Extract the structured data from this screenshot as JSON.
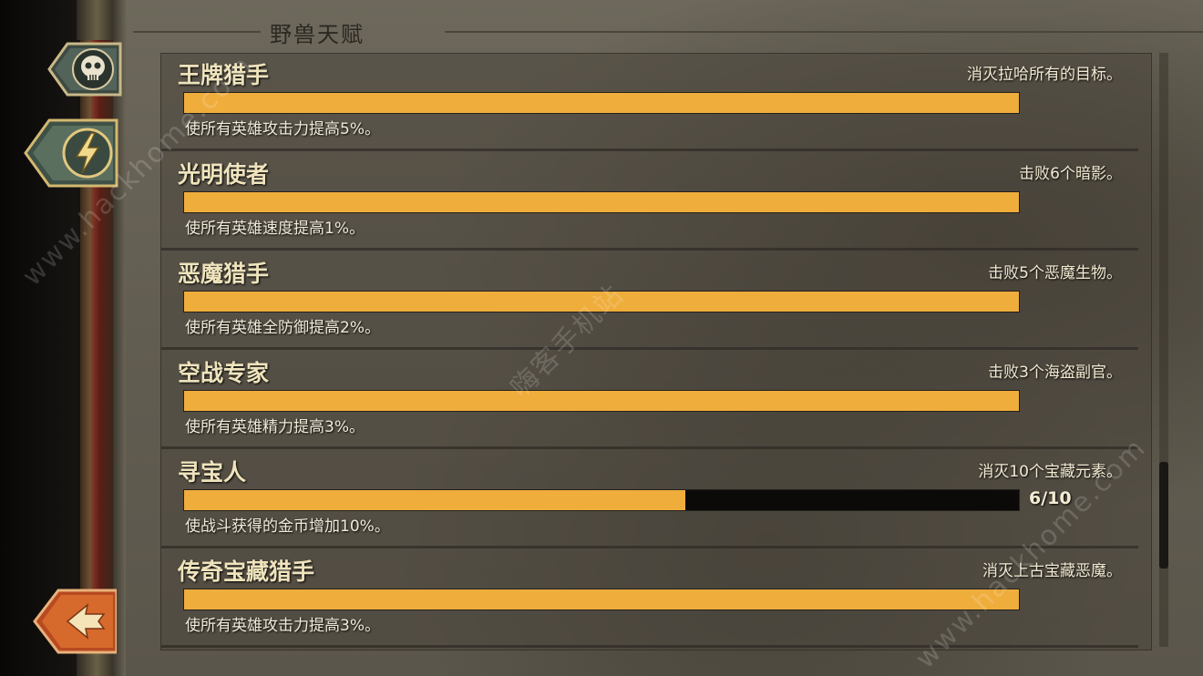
{
  "panel": {
    "title": "野兽天赋"
  },
  "talents": [
    {
      "name": "王牌猎手",
      "task": "消灭拉哈所有的目标。",
      "progress": 1.0,
      "count": "",
      "effect": "使所有英雄攻击力提高5%。"
    },
    {
      "name": "光明使者",
      "task": "击败6个暗影。",
      "progress": 1.0,
      "count": "",
      "effect": "使所有英雄速度提高1%。"
    },
    {
      "name": "恶魔猎手",
      "task": "击败5个恶魔生物。",
      "progress": 1.0,
      "count": "",
      "effect": "使所有英雄全防御提高2%。"
    },
    {
      "name": "空战专家",
      "task": "击败3个海盗副官。",
      "progress": 1.0,
      "count": "",
      "effect": "使所有英雄精力提高3%。"
    },
    {
      "name": "寻宝人",
      "task": "消灭10个宝藏元素。",
      "progress": 0.6,
      "count": "6/10",
      "effect": "使战斗获得的金币增加10%。"
    },
    {
      "name": "传奇宝藏猎手",
      "task": "消灭上古宝藏恶魔。",
      "progress": 1.0,
      "count": "",
      "effect": "使所有英雄攻击力提高3%。"
    }
  ],
  "scroll": {
    "position": 0.82,
    "visible_fraction": 0.18
  },
  "side_buttons": [
    {
      "icon": "skull-icon"
    },
    {
      "icon": "lightning-icon"
    },
    {
      "icon": "back-arrow-icon"
    }
  ],
  "watermarks": [
    "www.hackhome.com",
    "嗨客手机站",
    "www.hackhome.com"
  ],
  "colors": {
    "bar_fill": "#efad3c",
    "bar_empty": "#0b0a09",
    "text": "#eee3bc"
  }
}
